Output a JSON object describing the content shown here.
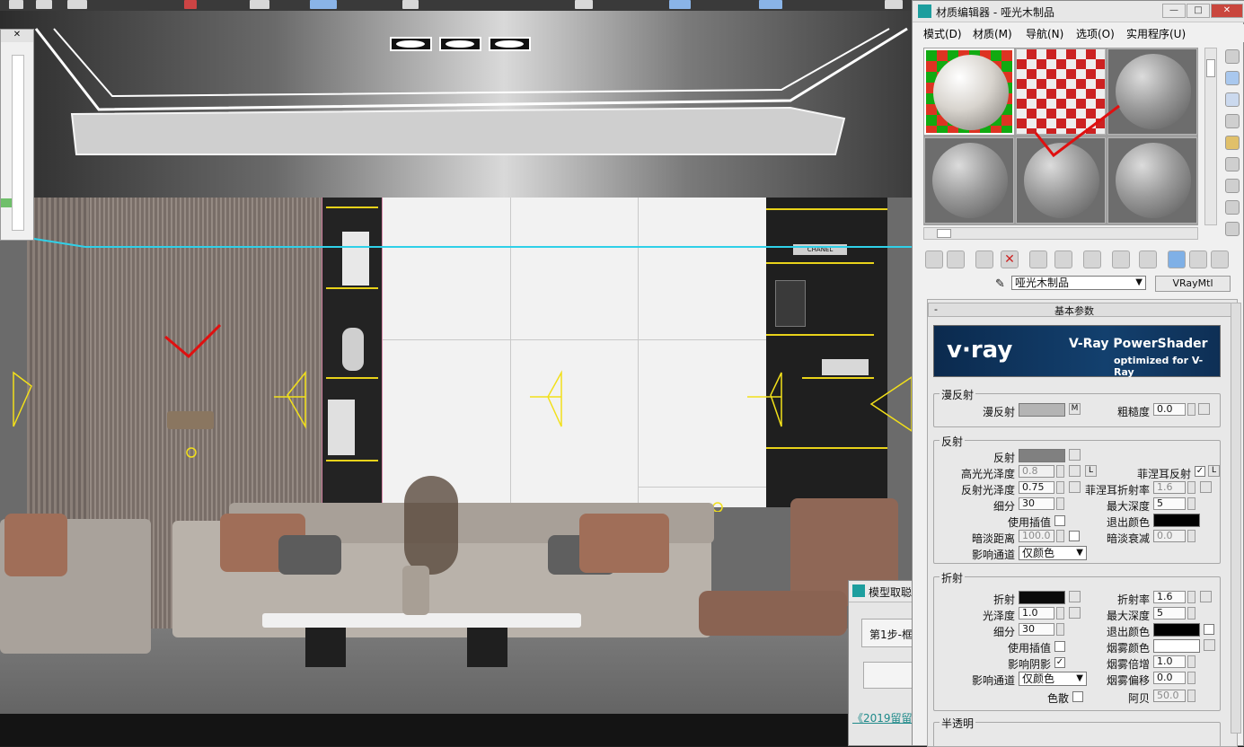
{
  "viewport": {
    "shelf_books_label": "CHANEL",
    "link_text": "《2019留留"
  },
  "model_dialog": {
    "title": "模型取聪",
    "step_label": "第1步-框"
  },
  "material_editor": {
    "title": "材质编辑器 - 哑光木制品",
    "window_buttons": {
      "minimize": "—",
      "restore": "□",
      "close": "✕"
    },
    "menu": [
      "模式(D)",
      "材质(M)",
      "导航(N)",
      "选项(O)",
      "实用程序(U)"
    ],
    "material_name": "哑光木制品",
    "material_type": "VRayMtl",
    "rollout_title": "基本参数",
    "rollout_collapse": "-",
    "banner": {
      "logo": "v·ray",
      "title": "V-Ray PowerShader",
      "subtitle": "optimized for V-Ray"
    },
    "diffuse": {
      "group": "漫反射",
      "diffuse_label": "漫反射",
      "diffuse_map": "M",
      "roughness_label": "粗糙度",
      "roughness_value": "0.0"
    },
    "reflection": {
      "group": "反射",
      "reflect_label": "反射",
      "hilight_gloss_label": "高光光泽度",
      "hilight_gloss_value": "0.8",
      "lock_button": "L",
      "fresnel_label": "菲涅耳反射",
      "fresnel_checked": "✓",
      "fresnel_lock": "L",
      "refl_gloss_label": "反射光泽度",
      "refl_gloss_value": "0.75",
      "fresnel_ior_label": "菲涅耳折射率",
      "fresnel_ior_value": "1.6",
      "subdivs_label": "细分",
      "subdivs_value": "30",
      "max_depth_label": "最大深度",
      "max_depth_value": "5",
      "use_interp_label": "使用插值",
      "exit_color_label": "退出颜色",
      "dim_distance_label": "暗淡距离",
      "dim_distance_value": "100.0",
      "dim_falloff_label": "暗淡衰减",
      "dim_falloff_value": "0.0",
      "affect_channels_label": "影响通道",
      "affect_channels_value": "仅颜色"
    },
    "refraction": {
      "group": "折射",
      "refract_label": "折射",
      "ior_label": "折射率",
      "ior_value": "1.6",
      "gloss_label": "光泽度",
      "gloss_value": "1.0",
      "max_depth_label": "最大深度",
      "max_depth_value": "5",
      "subdivs_label": "细分",
      "subdivs_value": "30",
      "exit_color_label": "退出颜色",
      "use_interp_label": "使用插值",
      "fog_color_label": "烟雾颜色",
      "affect_shadows_label": "影响阴影",
      "affect_shadows_checked": "✓",
      "fog_mult_label": "烟雾倍增",
      "fog_mult_value": "1.0",
      "affect_channels_label": "影响通道",
      "affect_channels_value": "仅颜色",
      "fog_bias_label": "烟雾偏移",
      "fog_bias_value": "0.0",
      "dispersion_label": "色散",
      "abbe_label": "阿贝",
      "abbe_value": "50.0"
    },
    "translucency_group": "半透明",
    "colors": {
      "diffuse": "#b4b4b4",
      "reflect": "#808080",
      "refract": "#0a0a0a",
      "exit": "#000000",
      "fog": "#ffffff",
      "accent": "#2f6fb8"
    }
  }
}
